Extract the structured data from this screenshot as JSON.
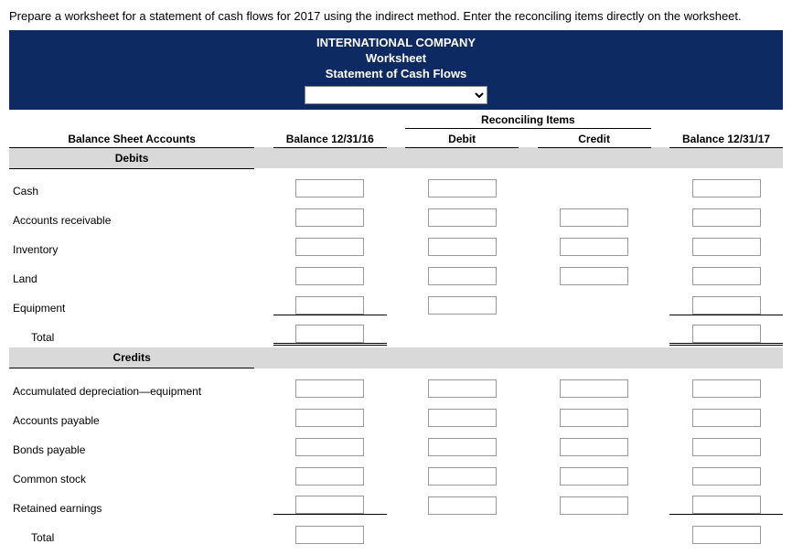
{
  "instruction": "Prepare a worksheet for a statement of cash flows for 2017 using the indirect method. Enter the reconciling items directly on the worksheet.",
  "header": {
    "company": "INTERNATIONAL COMPANY",
    "title": "Worksheet",
    "subtitle": "Statement of Cash Flows",
    "selector_value": ""
  },
  "columns": {
    "accounts": "Balance Sheet Accounts",
    "bal_begin": "Balance 12/31/16",
    "recon_group": "Reconciling Items",
    "debit": "Debit",
    "credit": "Credit",
    "bal_end": "Balance 12/31/17"
  },
  "sections": {
    "debits": "Debits",
    "credits": "Credits"
  },
  "rows": {
    "cash": "Cash",
    "ar": "Accounts receivable",
    "inv": "Inventory",
    "land": "Land",
    "equip": "Equipment",
    "total1": "Total",
    "accdep": "Accumulated depreciation—equipment",
    "ap": "Accounts payable",
    "bp": "Bonds payable",
    "cs": "Common stock",
    "re": "Retained earnings",
    "total2": "Total"
  }
}
